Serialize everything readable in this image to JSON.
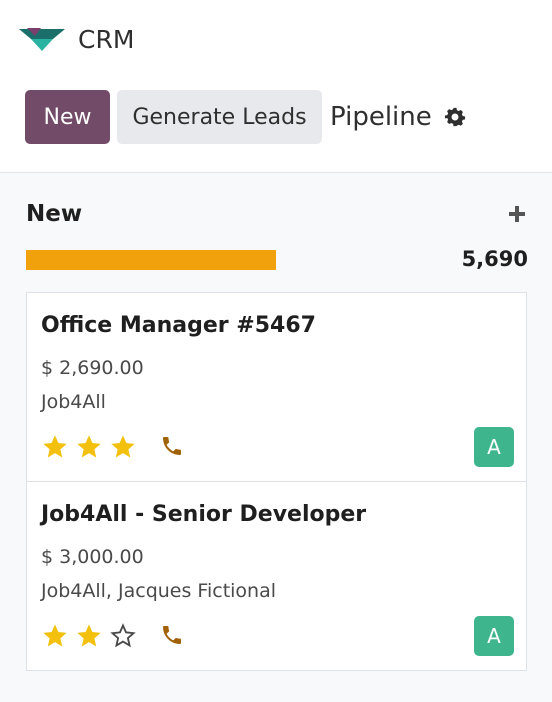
{
  "app": {
    "name": "CRM"
  },
  "toolbar": {
    "new_label": "New",
    "generate_label": "Generate Leads",
    "view_title": "Pipeline"
  },
  "column": {
    "title": "New",
    "total": "5,690",
    "progress_color": "#f0a10b"
  },
  "cards": [
    {
      "title": "Office Manager #5467",
      "amount": "$ 2,690.00",
      "company": "Job4All",
      "stars": 3,
      "max_stars": 3,
      "avatar": "A"
    },
    {
      "title": "Job4All - Senior Developer",
      "amount": "$ 3,000.00",
      "company": "Job4All, Jacques Fictional",
      "stars": 2,
      "max_stars": 3,
      "avatar": "A"
    }
  ],
  "colors": {
    "primary": "#714b67",
    "star": "#f3c10d",
    "phone": "#a16207",
    "avatar": "#3fb58e"
  }
}
